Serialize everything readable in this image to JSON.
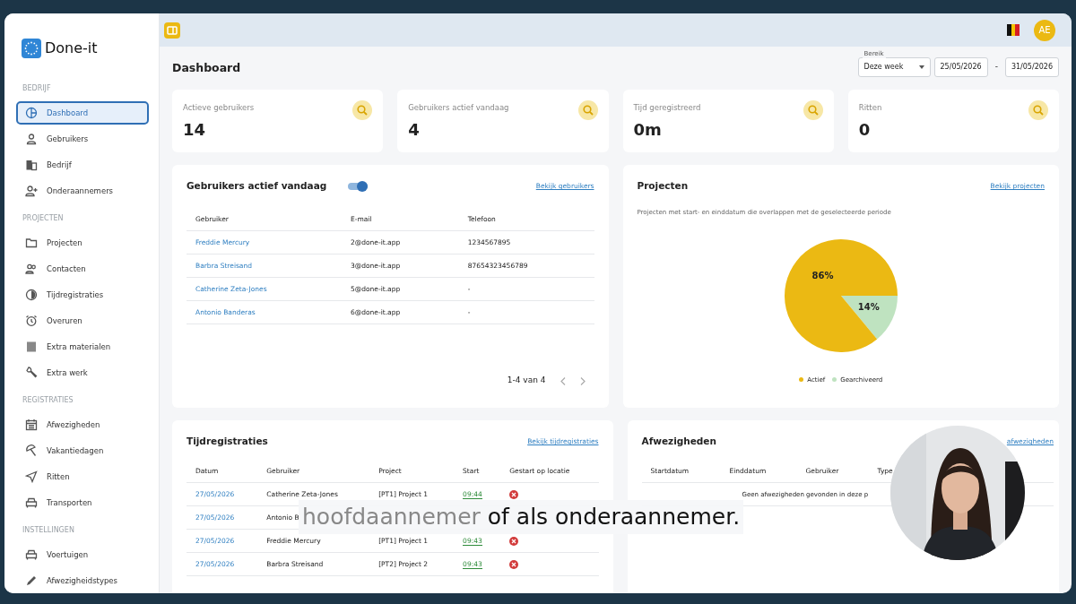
{
  "brand": {
    "name": "Done-it"
  },
  "sidebar": {
    "sections": [
      {
        "heading": "BEDRIJF",
        "items": [
          {
            "label": "Dashboard",
            "selected": true
          },
          {
            "label": "Gebruikers",
            "selected": false
          },
          {
            "label": "Bedrijf",
            "selected": false
          },
          {
            "label": "Onderaannemers",
            "selected": false
          }
        ]
      },
      {
        "heading": "PROJECTEN",
        "items": [
          {
            "label": "Projecten",
            "selected": false
          },
          {
            "label": "Contacten",
            "selected": false
          },
          {
            "label": "Tijdregistraties",
            "selected": false
          },
          {
            "label": "Overuren",
            "selected": false
          },
          {
            "label": "Extra materialen",
            "selected": false
          },
          {
            "label": "Extra werk",
            "selected": false
          }
        ]
      },
      {
        "heading": "REGISTRATIES",
        "items": [
          {
            "label": "Afwezigheden",
            "selected": false
          },
          {
            "label": "Vakantiedagen",
            "selected": false
          },
          {
            "label": "Ritten",
            "selected": false
          },
          {
            "label": "Transporten",
            "selected": false
          }
        ]
      },
      {
        "heading": "INSTELLINGEN",
        "items": [
          {
            "label": "Voertuigen",
            "selected": false
          },
          {
            "label": "Afwezigheidstypes",
            "selected": false
          }
        ]
      }
    ]
  },
  "topbar": {
    "avatar": "AE"
  },
  "page_title": "Dashboard",
  "range": {
    "legend": "Bereik",
    "value": "Deze week",
    "start": "25/05/2026",
    "separator": "-",
    "end": "31/05/2026"
  },
  "stats": [
    {
      "label": "Actieve gebruikers",
      "value": "14"
    },
    {
      "label": "Gebruikers actief vandaag",
      "value": "4"
    },
    {
      "label": "Tijd geregistreerd",
      "value": "0m"
    },
    {
      "label": "Ritten",
      "value": "0"
    }
  ],
  "active_users": {
    "title": "Gebruikers actief vandaag",
    "toggle_on": true,
    "link": "Bekijk gebruikers",
    "columns": [
      "Gebruiker",
      "E-mail",
      "Telefoon"
    ],
    "rows": [
      [
        "Freddie Mercury",
        "2@done-it.app",
        "1234567895"
      ],
      [
        "Barbra Streisand",
        "3@done-it.app",
        "87654323456789"
      ],
      [
        "Catherine Zeta-Jones",
        "5@done-it.app",
        "-"
      ],
      [
        "Antonio Banderas",
        "6@done-it.app",
        "-"
      ]
    ],
    "pagination": "1-4 van 4"
  },
  "projects": {
    "title": "Projecten",
    "link": "Bekijk projecten",
    "subtitle": "Projecten met start- en einddatum die overlappen met de geselecteerde periode",
    "chart_data": {
      "type": "pie",
      "categories": [
        "Actief",
        "Gearchiveerd"
      ],
      "values": [
        86,
        14
      ],
      "colors": [
        "#ebb913",
        "#bfe3c0"
      ],
      "value_labels": [
        "86%",
        "14%"
      ],
      "legend": "bottom"
    }
  },
  "time_registrations": {
    "title": "Tijdregistraties",
    "link": "Bekijk tijdregistraties",
    "columns": [
      "Datum",
      "Gebruiker",
      "Project",
      "Start",
      "Gestart op locatie"
    ],
    "rows": [
      {
        "date": "27/05/2026",
        "user": "Catherine Zeta-Jones",
        "project": "[PT1] Project 1",
        "start": "09:44",
        "on_location": false
      },
      {
        "date": "27/05/2026",
        "user": "Antonio B"
      },
      {
        "date": "27/05/2026",
        "user": "Freddie Mercury",
        "project": "[PT1] Project 1",
        "start": "09:43",
        "on_location": false
      },
      {
        "date": "27/05/2026",
        "user": "Barbra Streisand",
        "project": "[PT2] Project 2",
        "start": "09:43",
        "on_location": false
      }
    ]
  },
  "absences": {
    "title": "Afwezigheden",
    "link": "afwezigheden",
    "columns": [
      "Startdatum",
      "Einddatum",
      "Gebruiker",
      "Type"
    ],
    "empty": "Geen afwezigheden gevonden in deze p"
  },
  "caption": [
    {
      "text": "hoofdaannemer",
      "highlighted": false
    },
    {
      "text": "of als onderaannemer.",
      "highlighted": true
    }
  ]
}
